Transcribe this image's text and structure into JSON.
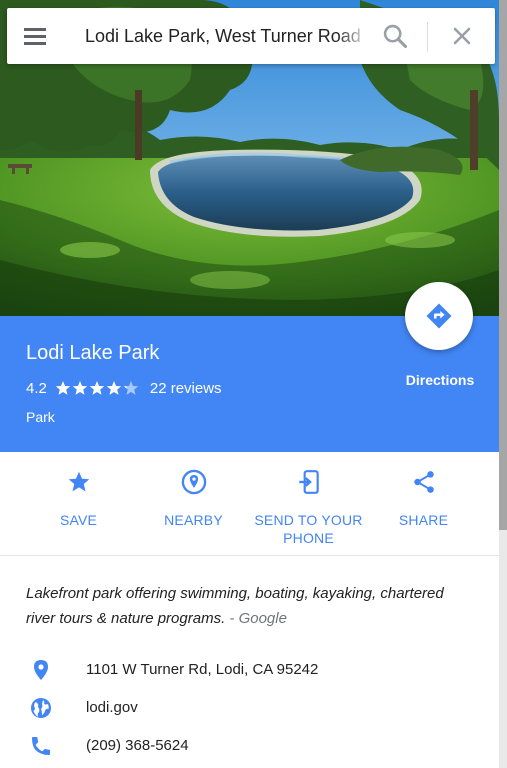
{
  "search": {
    "value": "Lodi Lake Park, West Turner Road"
  },
  "place": {
    "name": "Lodi Lake Park",
    "rating": "4.2",
    "rating_fraction": 0.84,
    "reviews": "22 reviews",
    "type": "Park",
    "directions_label": "Directions"
  },
  "actions": [
    {
      "label": "SAVE",
      "icon": "star-icon"
    },
    {
      "label": "NEARBY",
      "icon": "nearby-pin-icon"
    },
    {
      "label": "SEND TO YOUR PHONE",
      "icon": "send-to-phone-icon"
    },
    {
      "label": "SHARE",
      "icon": "share-icon"
    }
  ],
  "description": {
    "text": "Lakefront park offering swimming, boating, kayaking, chartered river tours & nature programs.",
    "attribution": "- Google"
  },
  "info": {
    "address": "1101 W Turner Rd, Lodi, CA 95242",
    "website": "lodi.gov",
    "phone": "(209) 368-5624"
  },
  "colors": {
    "accent": "#4285f4",
    "header_text": "#ffffff",
    "icon_grey": "#5f6368"
  }
}
